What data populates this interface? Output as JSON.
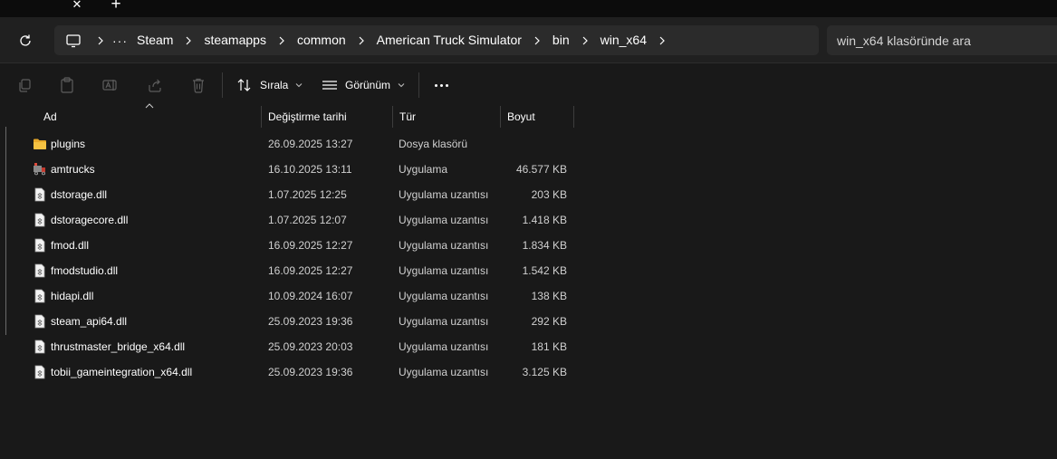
{
  "window": {
    "close_tab_glyph": "✕",
    "new_tab_glyph": "+"
  },
  "address": {
    "more_glyph": "···",
    "crumbs": [
      "Steam",
      "steamapps",
      "common",
      "American Truck Simulator",
      "bin",
      "win_x64"
    ]
  },
  "search": {
    "placeholder": "win_x64 klasöründe ara"
  },
  "toolbar": {
    "sort_label": "Sırala",
    "view_label": "Görünüm"
  },
  "columns": {
    "name": "Ad",
    "date": "Değiştirme tarihi",
    "type": "Tür",
    "size": "Boyut"
  },
  "files": [
    {
      "name": "plugins",
      "date": "26.09.2025 13:27",
      "type": "Dosya klasörü",
      "size": "",
      "icon": "folder-icon"
    },
    {
      "name": "amtrucks",
      "date": "16.10.2025 13:11",
      "type": "Uygulama",
      "size": "46.577 KB",
      "icon": "truck-app-icon"
    },
    {
      "name": "dstorage.dll",
      "date": "1.07.2025 12:25",
      "type": "Uygulama uzantısı",
      "size": "203 KB",
      "icon": "dll-file-icon"
    },
    {
      "name": "dstoragecore.dll",
      "date": "1.07.2025 12:07",
      "type": "Uygulama uzantısı",
      "size": "1.418 KB",
      "icon": "dll-file-icon"
    },
    {
      "name": "fmod.dll",
      "date": "16.09.2025 12:27",
      "type": "Uygulama uzantısı",
      "size": "1.834 KB",
      "icon": "dll-file-icon"
    },
    {
      "name": "fmodstudio.dll",
      "date": "16.09.2025 12:27",
      "type": "Uygulama uzantısı",
      "size": "1.542 KB",
      "icon": "dll-file-icon"
    },
    {
      "name": "hidapi.dll",
      "date": "10.09.2024 16:07",
      "type": "Uygulama uzantısı",
      "size": "138 KB",
      "icon": "dll-file-icon"
    },
    {
      "name": "steam_api64.dll",
      "date": "25.09.2023 19:36",
      "type": "Uygulama uzantısı",
      "size": "292 KB",
      "icon": "dll-file-icon"
    },
    {
      "name": "thrustmaster_bridge_x64.dll",
      "date": "25.09.2023 20:03",
      "type": "Uygulama uzantısı",
      "size": "181 KB",
      "icon": "dll-file-icon"
    },
    {
      "name": "tobii_gameintegration_x64.dll",
      "date": "25.09.2023 19:36",
      "type": "Uygulama uzantısı",
      "size": "3.125 KB",
      "icon": "dll-file-icon"
    }
  ],
  "colors": {
    "background": "#191919",
    "bar": "#202020",
    "field": "#2b2b2b",
    "folder": "#f5c242"
  }
}
